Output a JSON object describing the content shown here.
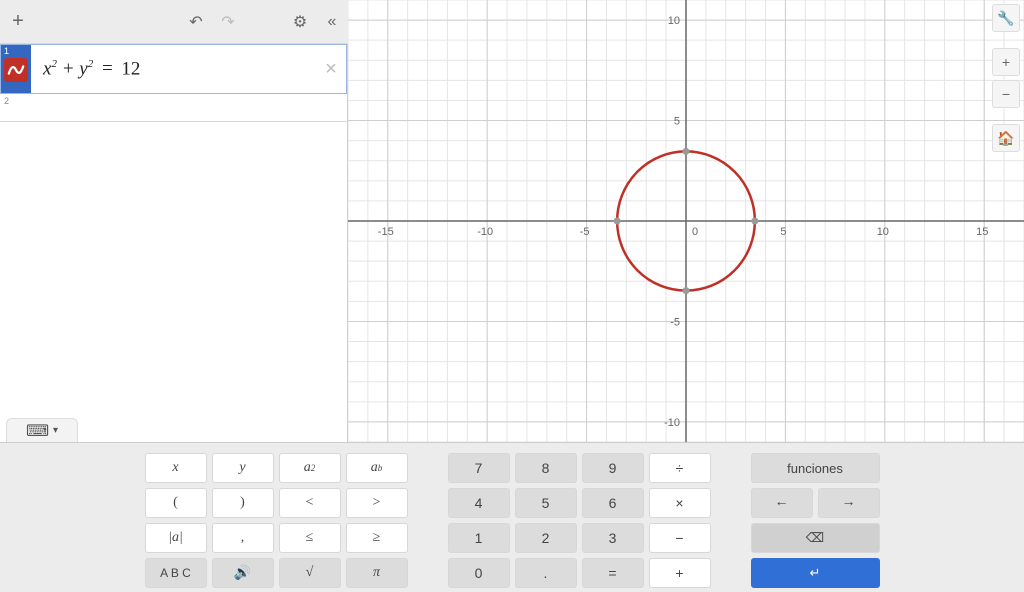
{
  "toolbar": {
    "add": "+",
    "undo": "↶",
    "redo": "↷",
    "settings": "⚙",
    "collapse": "«"
  },
  "expressions": [
    {
      "index": "1",
      "formula_parts": {
        "x": "x",
        "sq1": "2",
        "plus": " + ",
        "y": "y",
        "sq2": "2",
        "eq": " = ",
        "rhs": "12"
      }
    },
    {
      "index": "2"
    }
  ],
  "side": {
    "wrench": "🔧",
    "plus": "+",
    "minus": "−",
    "home": "🏠"
  },
  "keyboard_tab": {
    "icon": "⌨",
    "caret": "▾"
  },
  "keys_func": [
    [
      "x",
      "y",
      "a²",
      "aᵇ"
    ],
    [
      "(",
      ")",
      "<",
      ">"
    ],
    [
      "|a|",
      ",",
      "≤",
      "≥"
    ],
    [
      "A B C",
      "🔊",
      "√",
      "π"
    ]
  ],
  "keys_num": [
    [
      "7",
      "8",
      "9",
      "÷"
    ],
    [
      "4",
      "5",
      "6",
      "×"
    ],
    [
      "1",
      "2",
      "3",
      "−"
    ],
    [
      "0",
      ".",
      "=",
      "+"
    ]
  ],
  "keys_nav": {
    "funciones": "funciones",
    "left": "←",
    "right": "→",
    "backspace": "⌫",
    "enter": "↵"
  },
  "chart_data": {
    "type": "plot",
    "title": "",
    "series": [
      {
        "name": "x^2 + y^2 = 12",
        "kind": "circle",
        "center": [
          0,
          0
        ],
        "radius": 3.464,
        "color": "#c03027"
      }
    ],
    "intercepts": [
      [
        3.464,
        0
      ],
      [
        -3.464,
        0
      ],
      [
        0,
        3.464
      ],
      [
        0,
        -3.464
      ]
    ],
    "xaxis": {
      "min": -17,
      "max": 17,
      "ticks": [
        -15,
        -10,
        -5,
        0,
        5,
        10,
        15
      ]
    },
    "yaxis": {
      "min": -11,
      "max": 11,
      "ticks": [
        -10,
        -5,
        5,
        10
      ]
    },
    "grid": true
  }
}
